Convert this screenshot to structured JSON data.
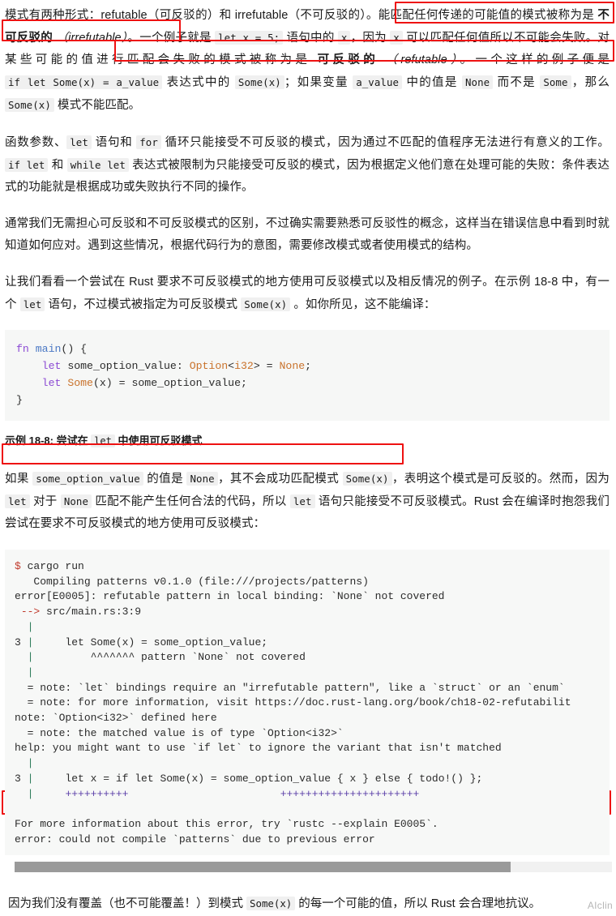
{
  "page": {
    "watermark": "AIclin"
  },
  "paragraphs": {
    "p1": {
      "seg1": "模式有两种形式：refutable（可反驳的）和 irrefutable（不可反驳的）。",
      "seg2": "能匹配任何传递的可能值的模式被称为是 ",
      "bold1": "不可反驳的",
      "italic1": "（irrefutable）",
      "seg3": "。一个例子就是 ",
      "code1": "let x = 5;",
      "seg4": " 语句中的 ",
      "code2": "x",
      "seg5": "，因为 ",
      "code3": "x",
      "seg6": " 可以匹配任何值所以不可能会失败。",
      "seg7": "对某些可能的值进行匹配会失败的模式被称为是 ",
      "bold2": "可反驳的",
      "italic2": "（refutable）",
      "seg8": "。一个这样的例子便是 ",
      "code4": "if let Some(x) = a_value",
      "seg9": " 表达式中的 ",
      "code5": "Some(x)",
      "seg10": "；如果变量 ",
      "code6": "a_value",
      "seg11": " 中的值是 ",
      "code7": "None",
      "seg12": " 而不是 ",
      "code8": "Some",
      "seg13": "，那么 ",
      "code9": "Some(x)",
      "seg14": " 模式不能匹配。"
    },
    "p2": {
      "seg1": "函数参数、",
      "code1": "let",
      "seg2": " 语句和 ",
      "code2": "for",
      "seg3": " 循环只能接受不可反驳的模式，因为通过不匹配的值程序无法进行有意义的工作。",
      "code3": "if let",
      "seg4": " 和 ",
      "code4": "while let",
      "seg5": " 表达式被限制为只能接受可反驳的模式，因为根据定义他们意在处理可能的失败：条件表达式的功能就是根据成功或失败执行不同的操作。"
    },
    "p3": {
      "text": "通常我们无需担心可反驳和不可反驳模式的区别，不过确实需要熟悉可反驳性的概念，这样当在错误信息中看到时就知道如何应对。遇到这些情况，根据代码行为的意图，需要修改模式或者使用模式的结构。"
    },
    "p4": {
      "seg1": "让我们看看一个尝试在 Rust 要求不可反驳模式的地方使用可反驳模式以及相反情况的例子。在示例 18-8 中，有一个 ",
      "code1": "let",
      "seg2": " 语句，不过模式被指定为可反驳模式 ",
      "code2": "Some(x)",
      "seg3": " 。如你所见，这不能编译："
    },
    "p5": {
      "seg1": "如果 ",
      "code1": "some_option_value",
      "seg2": " 的值是 ",
      "code2": "None",
      "seg3": "，其不会成功匹配模式 ",
      "code3": "Some(x)",
      "seg4": "，表明这个模式是可反驳的。然而，因为 ",
      "code4": "let",
      "seg5": " 对于 ",
      "code5": "None",
      "seg6": " 匹配不能产生任何合法的代码，所以 ",
      "code6": "let",
      "seg7": " 语句只能接受不可反驳模式。Rust 会在编译时抱怨我们尝试在要求不可反驳模式的地方使用可反驳模式："
    },
    "p6": {
      "seg1": "因为我们没有覆盖（也不可能覆盖！）到模式 ",
      "code1": "Some(x)",
      "seg2": " 的每一个可能的值，所以 Rust 会合理地抗议。"
    }
  },
  "caption": {
    "prefix": "示例 18-8: 尝试在 ",
    "code": "let",
    "suffix": " 中使用可反驳模式"
  },
  "code_block": {
    "language": "rust",
    "lines": [
      {
        "tokens": [
          {
            "t": "fn ",
            "c": "kw"
          },
          {
            "t": "main",
            "c": "fnname"
          },
          {
            "t": "() {",
            "c": "pl"
          }
        ]
      },
      {
        "tokens": [
          {
            "t": "    ",
            "c": "pl"
          },
          {
            "t": "let ",
            "c": "kw"
          },
          {
            "t": "some_option_value: ",
            "c": "pl"
          },
          {
            "t": "Option",
            "c": "ty"
          },
          {
            "t": "<",
            "c": "pl"
          },
          {
            "t": "i32",
            "c": "ty"
          },
          {
            "t": "> = ",
            "c": "pl"
          },
          {
            "t": "None",
            "c": "ty"
          },
          {
            "t": ";",
            "c": "pl"
          }
        ]
      },
      {
        "tokens": [
          {
            "t": "    ",
            "c": "pl"
          },
          {
            "t": "let ",
            "c": "kw"
          },
          {
            "t": "Some",
            "c": "ty"
          },
          {
            "t": "(x) = some_option_value;",
            "c": "pl"
          }
        ]
      },
      {
        "tokens": [
          {
            "t": "}",
            "c": "pl"
          }
        ]
      }
    ]
  },
  "terminal": {
    "lines": [
      {
        "tokens": [
          {
            "t": "$",
            "c": "t-dollar"
          },
          {
            "t": " cargo run",
            "c": "pl"
          }
        ]
      },
      {
        "tokens": [
          {
            "t": "   Compiling patterns v0.1.0 (file:///projects/patterns)",
            "c": "pl"
          }
        ]
      },
      {
        "tokens": [
          {
            "t": "error[E0005]: refutable pattern in local binding: `None` not covered",
            "c": "pl"
          }
        ]
      },
      {
        "tokens": [
          {
            "t": " ",
            "c": "pl"
          },
          {
            "t": "-->",
            "c": "t-arrow"
          },
          {
            "t": " src/main.rs:3:9",
            "c": "pl"
          }
        ]
      },
      {
        "tokens": [
          {
            "t": "  ",
            "c": "pl"
          },
          {
            "t": "|",
            "c": "t-pipe"
          }
        ]
      },
      {
        "tokens": [
          {
            "t": "3 ",
            "c": "pl"
          },
          {
            "t": "|",
            "c": "t-pipe"
          },
          {
            "t": "     let Some(x) = some_option_value;",
            "c": "pl"
          }
        ]
      },
      {
        "tokens": [
          {
            "t": "  ",
            "c": "pl"
          },
          {
            "t": "|",
            "c": "t-pipe"
          },
          {
            "t": "         ^^^^^^^ pattern `None` not covered",
            "c": "pl"
          }
        ]
      },
      {
        "tokens": [
          {
            "t": "  ",
            "c": "pl"
          },
          {
            "t": "|",
            "c": "t-pipe"
          }
        ]
      },
      {
        "tokens": [
          {
            "t": "  = note: `let` bindings require an \"irrefutable pattern\", like a `struct` or an `enum`",
            "c": "pl"
          }
        ]
      },
      {
        "tokens": [
          {
            "t": "  = note: for more information, visit https://doc.rust-lang.org/book/ch18-02-refutabilit",
            "c": "pl"
          }
        ]
      },
      {
        "tokens": [
          {
            "t": "note: `Option<i32>` defined here",
            "c": "pl"
          }
        ]
      },
      {
        "tokens": [
          {
            "t": "  = note: the matched value is of type `Option<i32>`",
            "c": "pl"
          }
        ]
      },
      {
        "tokens": [
          {
            "t": "help: you might want to use `if let` to ignore the variant that isn't matched",
            "c": "pl"
          }
        ]
      },
      {
        "tokens": [
          {
            "t": "  ",
            "c": "pl"
          },
          {
            "t": "|",
            "c": "t-pipe"
          }
        ]
      },
      {
        "tokens": [
          {
            "t": "3 ",
            "c": "pl"
          },
          {
            "t": "|",
            "c": "t-pipe"
          },
          {
            "t": "     let x = if let Some(x) = some_option_value { x } else { todo!() };",
            "c": "pl"
          }
        ]
      },
      {
        "tokens": [
          {
            "t": "  ",
            "c": "pl"
          },
          {
            "t": "|",
            "c": "t-pipe"
          },
          {
            "t": "     ",
            "c": "pl"
          },
          {
            "t": "++++++++++",
            "c": "t-plus"
          },
          {
            "t": "                        ",
            "c": "pl"
          },
          {
            "t": "++++++++++++++++++++++",
            "c": "t-plus"
          }
        ]
      },
      {
        "tokens": [
          {
            "t": "",
            "c": "pl"
          }
        ]
      },
      {
        "tokens": [
          {
            "t": "For more information about this error, try `rustc --explain E0005`.",
            "c": "pl"
          }
        ]
      },
      {
        "tokens": [
          {
            "t": "error: could not compile `patterns` due to previous error",
            "c": "pl"
          }
        ]
      }
    ]
  },
  "scrollbar": {
    "thumb_fraction": 0.83
  },
  "colors": {
    "highlight_box": "#ee1111",
    "code_bg": "#f6f7f6",
    "terminal_bg": "#f7f8f7",
    "keyword": "#8c4bd4",
    "type": "#c9722b",
    "function": "#4a78c4",
    "dollar": "#c0392b",
    "pipe": "#2f7d5c",
    "plus": "#5b3fa8"
  }
}
